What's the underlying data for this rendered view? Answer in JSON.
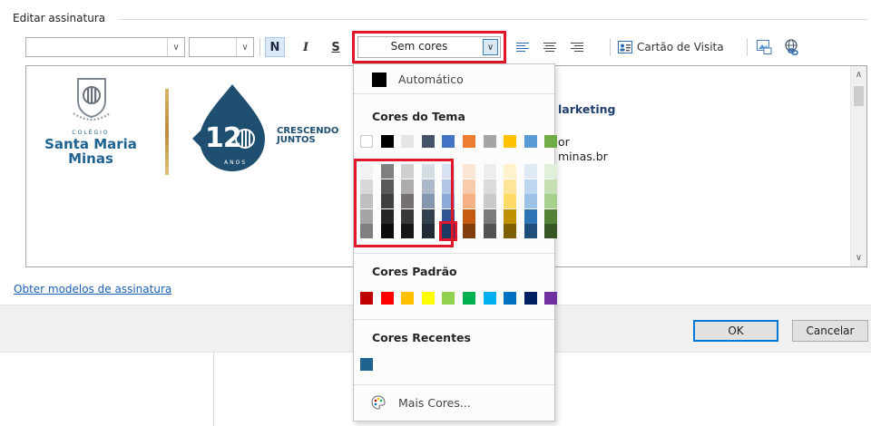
{
  "group": {
    "title": "Editar assinatura"
  },
  "toolbar": {
    "bold_label": "N",
    "italic_label": "I",
    "underline_label": "S",
    "color_value": "Sem cores",
    "business_card_label": "Cartão de Visita"
  },
  "signature": {
    "college_small": "COLÉGIO",
    "college_name_1": "Santa Maria",
    "college_name_2": "Minas",
    "anniversary_number": "12",
    "anniversary_sub": "ANOS",
    "slogan_1": "CRESCENDO",
    "slogan_2": "JUNTOS",
    "text_line_1": "larketing",
    "text_line_2": "or",
    "text_line_3": "minas.br"
  },
  "links": {
    "get_templates": "Obter modelos de assinatura"
  },
  "buttons": {
    "ok": "OK",
    "cancel": "Cancelar"
  },
  "color_menu": {
    "automatic": "Automático",
    "theme_header": "Cores do Tema",
    "standard_header": "Cores Padrão",
    "recent_header": "Cores Recentes",
    "more_colors": "Mais Cores...",
    "theme_top": [
      "#FFFFFF",
      "#000000",
      "#E7E6E6",
      "#44546A",
      "#4472C4",
      "#ED7D31",
      "#A5A5A5",
      "#FFC000",
      "#5B9BD5",
      "#70AD47"
    ],
    "theme_shades": [
      [
        "#F2F2F2",
        "#7F7F7F",
        "#D0CECE",
        "#D6DCE4",
        "#D9E2F3",
        "#FBE5D5",
        "#EDEDED",
        "#FFF2CC",
        "#DEEBF6",
        "#E2EFD9"
      ],
      [
        "#D8D8D8",
        "#595959",
        "#AEABAB",
        "#ADB9CA",
        "#B4C6E7",
        "#F7CBAC",
        "#DBDBDB",
        "#FFE599",
        "#BDD7EE",
        "#C5E0B3"
      ],
      [
        "#BFBFBF",
        "#3F3F3F",
        "#757070",
        "#8496B0",
        "#8EAADB",
        "#F4B183",
        "#C9C9C9",
        "#FFD966",
        "#9CC3E5",
        "#A8D08D"
      ],
      [
        "#A5A5A5",
        "#262626",
        "#3A3838",
        "#323F4F",
        "#2F5496",
        "#C55A11",
        "#7B7B7B",
        "#BF9000",
        "#2E75B5",
        "#538135"
      ],
      [
        "#7F7F7F",
        "#0C0C0C",
        "#171616",
        "#222A35",
        "#1F3864",
        "#833C0B",
        "#525252",
        "#7F6000",
        "#1E4E79",
        "#375623"
      ]
    ],
    "standard": [
      "#C00000",
      "#FF0000",
      "#FFC000",
      "#FFFF00",
      "#92D050",
      "#00B050",
      "#00B0F0",
      "#0070C0",
      "#002060",
      "#7030A0"
    ],
    "recent": [
      "#1F6391"
    ]
  },
  "highlight_color": "#E0162B",
  "icons": {
    "bold": "bold-icon",
    "italic": "italic-icon",
    "underline": "underline-icon",
    "align_left": "align-left-icon",
    "align_center": "align-center-icon",
    "align_right": "align-right-icon",
    "business_card": "business-card-icon",
    "picture": "insert-picture-icon",
    "hyperlink": "hyperlink-icon",
    "palette": "palette-icon"
  }
}
